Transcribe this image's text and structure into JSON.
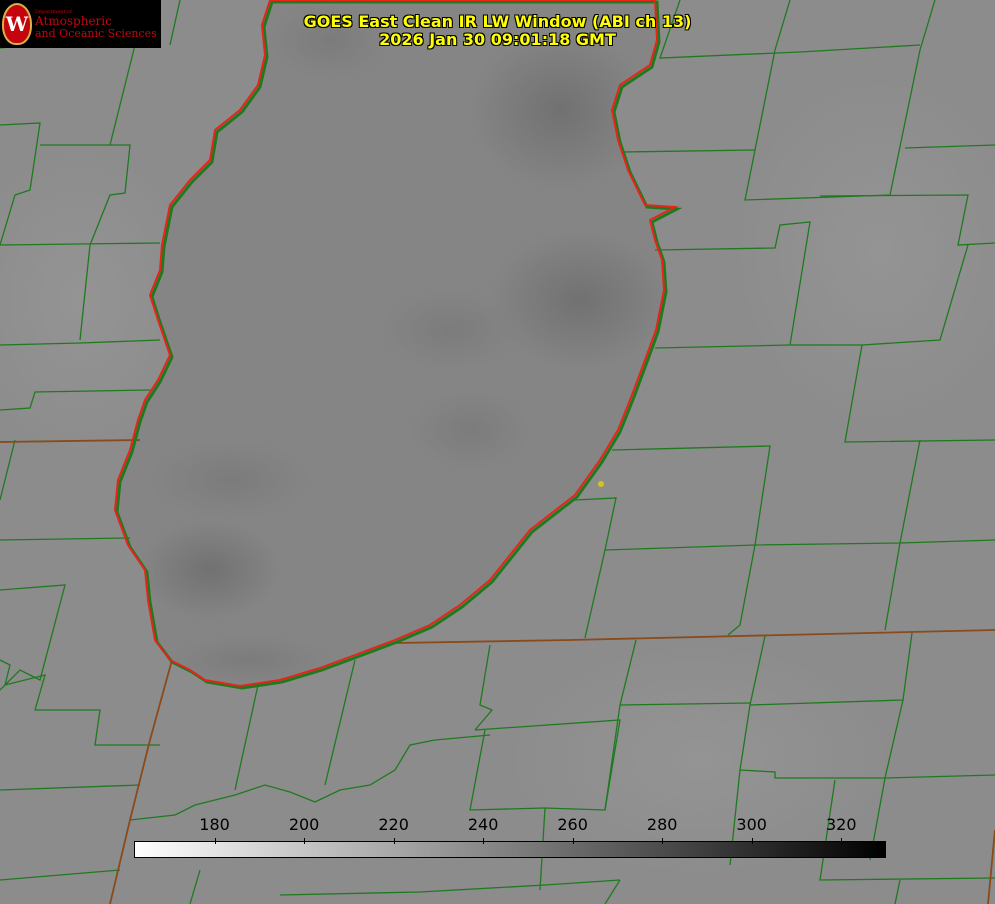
{
  "title": {
    "line1": "GOES East Clean IR LW Window (ABI ch 13)",
    "line2": "2026 Jan 30 09:01:18 GMT"
  },
  "logo": {
    "seal_letter": "W",
    "department": "Department of",
    "line1": "Atmospheric",
    "line2": "and Oceanic Sciences"
  },
  "colorbar": {
    "min": 162,
    "max": 330,
    "ticks": [
      "180",
      "200",
      "220",
      "240",
      "260",
      "280",
      "300",
      "320"
    ],
    "colors": {
      "low": "#ffffff",
      "high": "#000000"
    }
  },
  "colors": {
    "lake_shoreline": "#e8231a",
    "county_lines": "#1f7a1f",
    "state_lines": "#8a4a1a",
    "marker": "#d4c41a"
  }
}
